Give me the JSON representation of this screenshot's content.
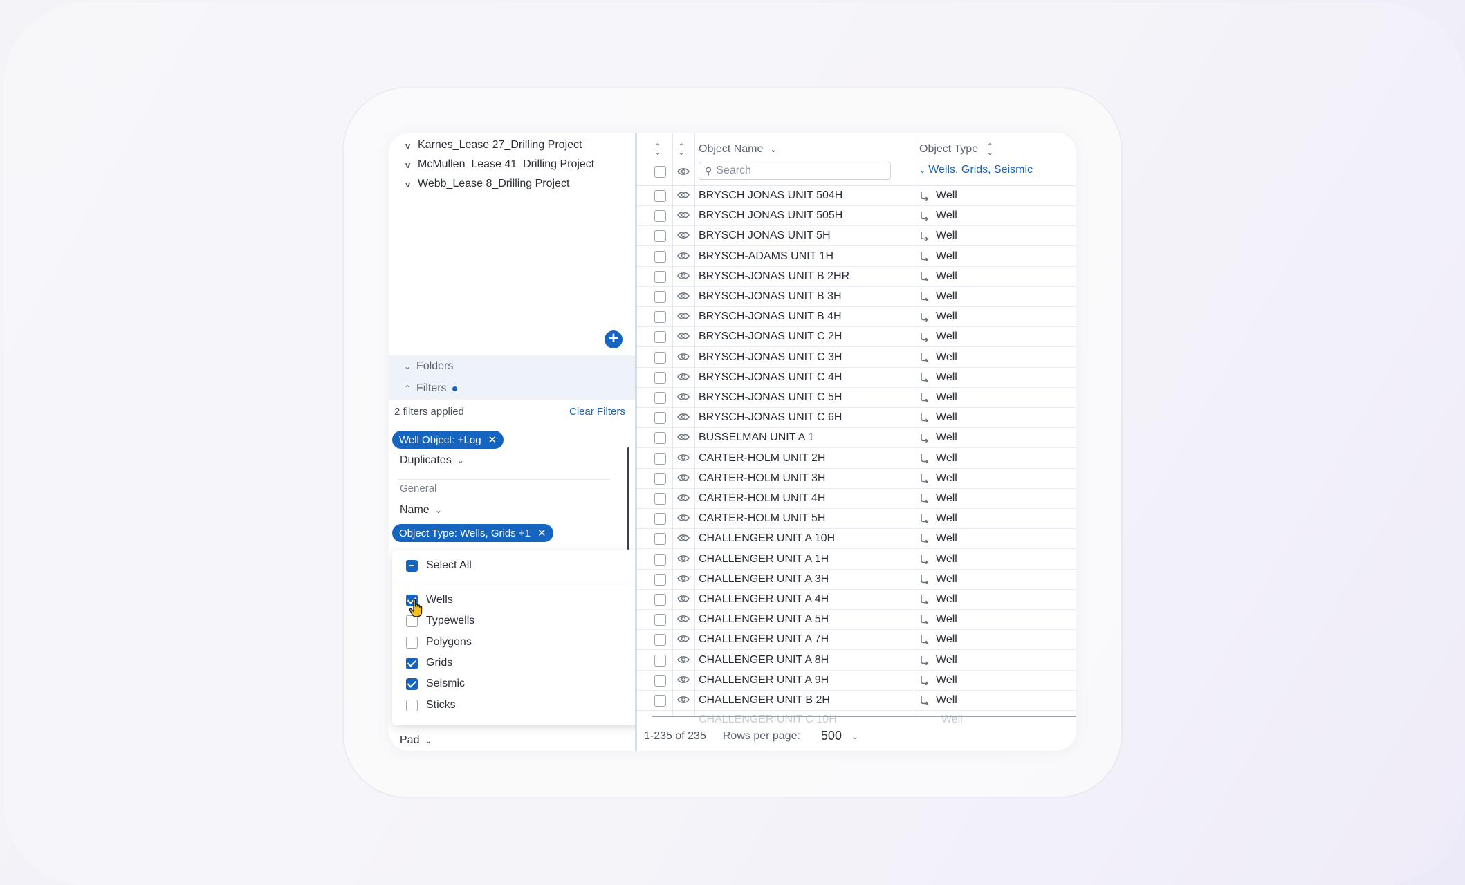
{
  "projects": [
    {
      "label": "Karnes_Lease 27_Drilling Project"
    },
    {
      "label": "McMullen_Lease 41_Drilling Project"
    },
    {
      "label": "Webb_Lease 8_Drilling Project"
    }
  ],
  "sections": {
    "folders": "Folders",
    "filters": "Filters"
  },
  "filters": {
    "applied_text": "2 filters applied",
    "clear_label": "Clear Filters",
    "chip_well_object": "Well Object: +Log",
    "duplicates_label": "Duplicates",
    "general_label": "General",
    "name_label": "Name",
    "chip_object_type": "Object Type: Wells, Grids +1",
    "pad_label": "Pad"
  },
  "dropdown": {
    "select_all": "Select All",
    "options": [
      {
        "label": "Wells",
        "checked": true
      },
      {
        "label": "Typewells",
        "checked": false
      },
      {
        "label": "Polygons",
        "checked": false
      },
      {
        "label": "Grids",
        "checked": true
      },
      {
        "label": "Seismic",
        "checked": true
      },
      {
        "label": "Sticks",
        "checked": false
      }
    ]
  },
  "table": {
    "col_object_name": "Object Name",
    "col_object_type": "Object Type",
    "search_placeholder": "Search",
    "type_filter_value": "Wells, Grids, Seismic",
    "rows": [
      {
        "name": "BRYSCH JONAS UNIT 504H",
        "type": "Well"
      },
      {
        "name": "BRYSCH JONAS UNIT 505H",
        "type": "Well"
      },
      {
        "name": "BRYSCH JONAS UNIT 5H",
        "type": "Well"
      },
      {
        "name": "BRYSCH-ADAMS UNIT 1H",
        "type": "Well"
      },
      {
        "name": "BRYSCH-JONAS UNIT B 2HR",
        "type": "Well"
      },
      {
        "name": "BRYSCH-JONAS UNIT B 3H",
        "type": "Well"
      },
      {
        "name": "BRYSCH-JONAS UNIT B 4H",
        "type": "Well"
      },
      {
        "name": "BRYSCH-JONAS UNIT C 2H",
        "type": "Well"
      },
      {
        "name": "BRYSCH-JONAS UNIT C 3H",
        "type": "Well"
      },
      {
        "name": "BRYSCH-JONAS UNIT C 4H",
        "type": "Well"
      },
      {
        "name": "BRYSCH-JONAS UNIT C 5H",
        "type": "Well"
      },
      {
        "name": "BRYSCH-JONAS UNIT C 6H",
        "type": "Well"
      },
      {
        "name": "BUSSELMAN UNIT A 1",
        "type": "Well"
      },
      {
        "name": "CARTER-HOLM UNIT 2H",
        "type": "Well"
      },
      {
        "name": "CARTER-HOLM UNIT 3H",
        "type": "Well"
      },
      {
        "name": "CARTER-HOLM UNIT 4H",
        "type": "Well"
      },
      {
        "name": "CARTER-HOLM UNIT 5H",
        "type": "Well"
      },
      {
        "name": "CHALLENGER UNIT A 10H",
        "type": "Well"
      },
      {
        "name": "CHALLENGER UNIT A 1H",
        "type": "Well"
      },
      {
        "name": "CHALLENGER UNIT A 3H",
        "type": "Well"
      },
      {
        "name": "CHALLENGER UNIT A 4H",
        "type": "Well"
      },
      {
        "name": "CHALLENGER UNIT A 5H",
        "type": "Well"
      },
      {
        "name": "CHALLENGER UNIT A 7H",
        "type": "Well"
      },
      {
        "name": "CHALLENGER UNIT A 8H",
        "type": "Well"
      },
      {
        "name": "CHALLENGER UNIT A 9H",
        "type": "Well"
      },
      {
        "name": "CHALLENGER UNIT B 2H",
        "type": "Well"
      }
    ]
  },
  "footer": {
    "range": "1-235 of 235",
    "rows_per_page_label": "Rows per page:",
    "rows_per_page_value": "500"
  },
  "colors": {
    "accent": "#1565c0",
    "text": "#2b2f38",
    "muted": "#5a6170"
  }
}
